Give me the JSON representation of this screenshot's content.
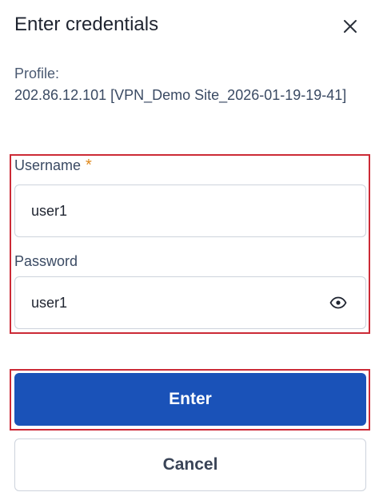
{
  "dialog": {
    "title": "Enter credentials",
    "close_icon": "close-icon"
  },
  "profile": {
    "label": "Profile:",
    "value": "202.86.12.101 [VPN_Demo Site_2026-01-19-19-41]"
  },
  "form": {
    "username": {
      "label": "Username",
      "required_marker": "*",
      "value": "user1"
    },
    "password": {
      "label": "Password",
      "value": "user1",
      "toggle_icon": "eye-icon"
    }
  },
  "actions": {
    "enter_label": "Enter",
    "cancel_label": "Cancel"
  },
  "colors": {
    "primary": "#1a52b8",
    "highlight": "#cc2a36",
    "required": "#e08a1e"
  }
}
